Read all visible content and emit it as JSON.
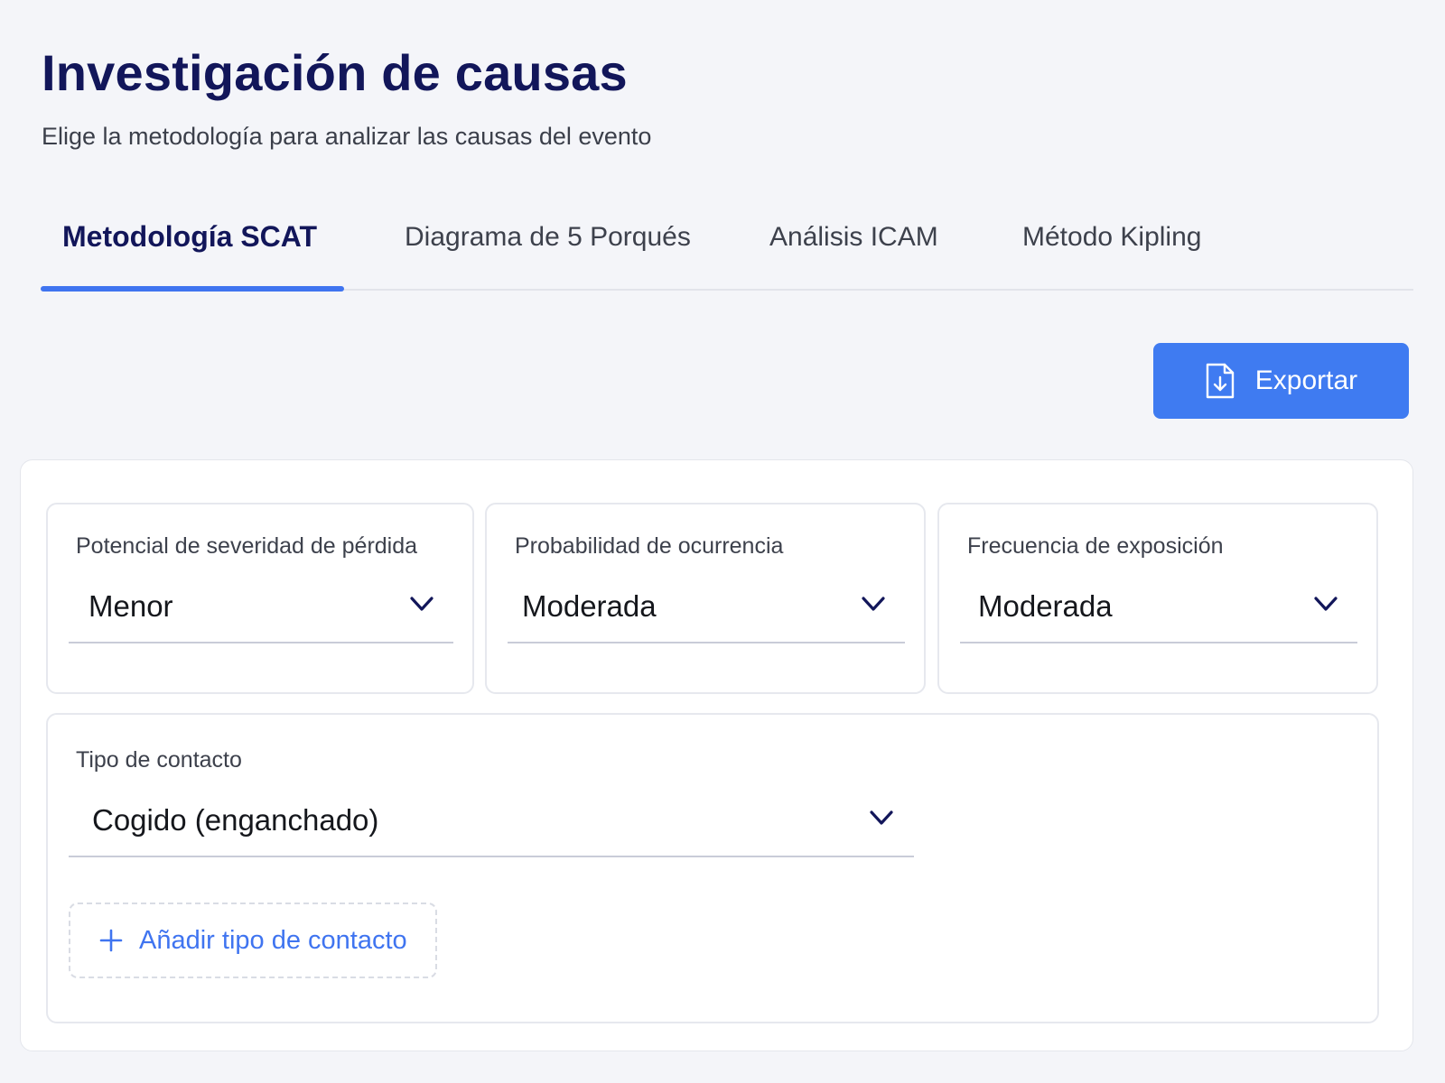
{
  "header": {
    "title": "Investigación de causas",
    "subtitle": "Elige la metodología para analizar las causas del evento"
  },
  "tabs": [
    {
      "label": "Metodología SCAT",
      "active": true
    },
    {
      "label": "Diagrama de 5 Porqués",
      "active": false
    },
    {
      "label": "Análisis ICAM",
      "active": false
    },
    {
      "label": "Método Kipling",
      "active": false
    }
  ],
  "toolbar": {
    "export_label": "Exportar",
    "export_icon": "file-download-icon"
  },
  "fields": {
    "severity": {
      "label": "Potencial de severidad de pérdida",
      "value": "Menor"
    },
    "probability": {
      "label": "Probabilidad de ocurrencia",
      "value": "Moderada"
    },
    "exposure": {
      "label": "Frecuencia de exposición",
      "value": "Moderada"
    },
    "contact_type": {
      "label": "Tipo de contacto",
      "value": "Cogido (enganchado)"
    }
  },
  "add_contact": {
    "label": "Añadir tipo de contacto",
    "icon": "plus-icon"
  },
  "colors": {
    "accent": "#3f7bf1",
    "title": "#12165a",
    "background": "#f4f5f9"
  }
}
